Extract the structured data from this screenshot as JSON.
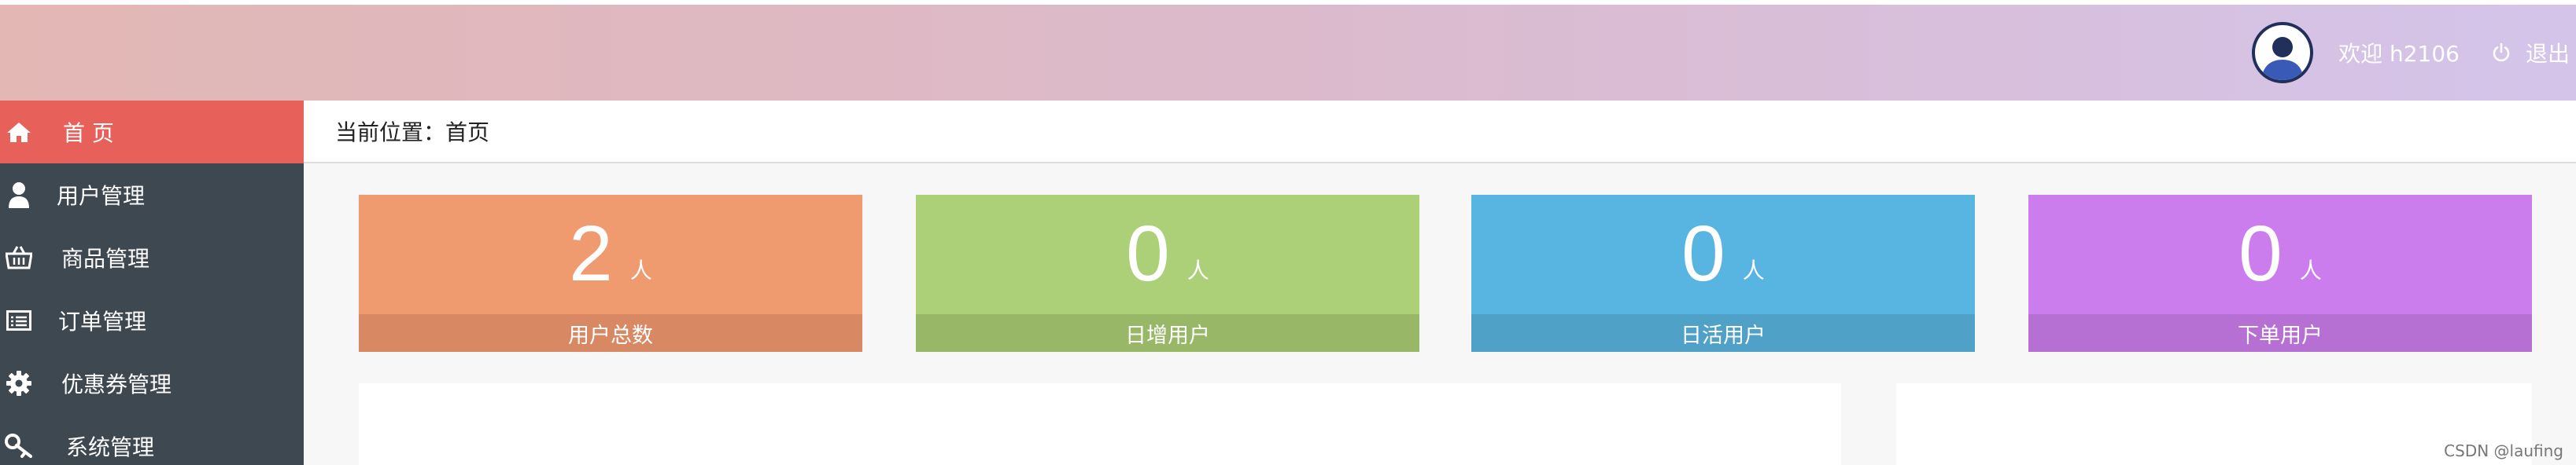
{
  "header": {
    "welcome": "欢迎 h2106",
    "logout_label": "退出",
    "gradient": [
      "#e2b7b4",
      "#d4c4ea"
    ]
  },
  "sidebar": {
    "items": [
      {
        "label": "首 页",
        "icon": "home-icon",
        "active": true
      },
      {
        "label": "用户管理",
        "icon": "user-icon",
        "active": false
      },
      {
        "label": "商品管理",
        "icon": "basket-icon",
        "active": false
      },
      {
        "label": "订单管理",
        "icon": "list-icon",
        "active": false
      },
      {
        "label": "优惠券管理",
        "icon": "gear-icon",
        "active": false
      },
      {
        "label": "系统管理",
        "icon": "key-icon",
        "active": false
      }
    ],
    "active_color": "#e8605a",
    "background": "#3e4850"
  },
  "breadcrumb": {
    "text": "当前位置：首页"
  },
  "stats": [
    {
      "value": "2",
      "unit": "人",
      "label": "用户总数",
      "color": "#f09a70",
      "footer_color": "#d98864"
    },
    {
      "value": "0",
      "unit": "人",
      "label": "日增用户",
      "color": "#abd077",
      "footer_color": "#98b767"
    },
    {
      "value": "0",
      "unit": "人",
      "label": "日活用户",
      "color": "#58b4e0",
      "footer_color": "#4fa1c8"
    },
    {
      "value": "0",
      "unit": "人",
      "label": "下单用户",
      "color": "#cc7ded",
      "footer_color": "#b670d4"
    }
  ],
  "watermark": "CSDN @laufing"
}
